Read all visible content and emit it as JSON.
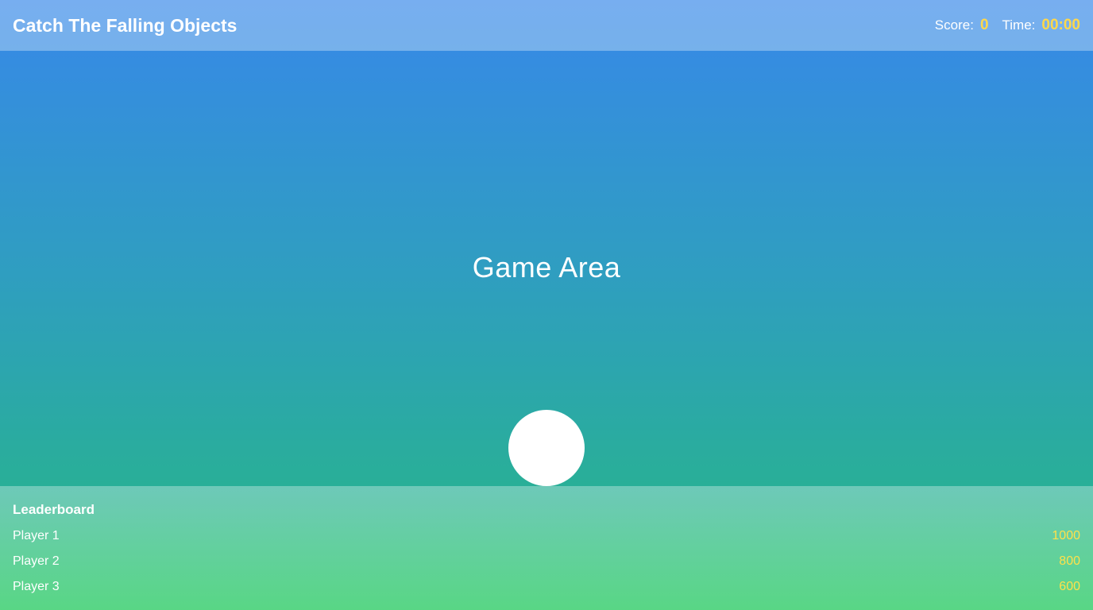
{
  "header": {
    "title": "Catch The Falling Objects",
    "score_label": "Score:",
    "score_value": "0",
    "time_label": "Time:",
    "time_value": "00:00"
  },
  "game": {
    "area_label": "Game Area"
  },
  "leaderboard": {
    "title": "Leaderboard",
    "entries": [
      {
        "name": "Player 1",
        "score": "1000"
      },
      {
        "name": "Player 2",
        "score": "800"
      },
      {
        "name": "Player 3",
        "score": "600"
      }
    ]
  },
  "colors": {
    "accent_yellow": "#ffd84a",
    "bg_top": "#3788e9",
    "bg_bottom": "#25b980"
  }
}
